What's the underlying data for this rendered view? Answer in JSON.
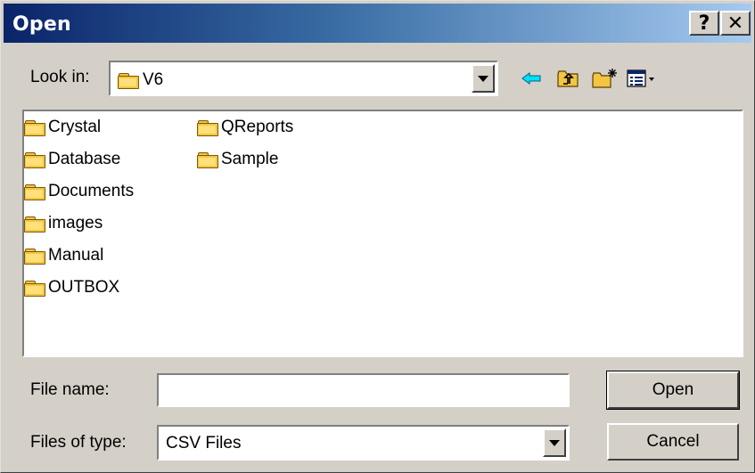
{
  "window": {
    "title": "Open",
    "help_label": "?",
    "close_label": "✕"
  },
  "look_in": {
    "label": "Look in:",
    "value": "V6"
  },
  "toolbar": {
    "back_icon": "arrow-left-icon",
    "up_icon": "up-folder-icon",
    "new_folder_icon": "new-folder-icon",
    "view_icon": "view-menu-icon"
  },
  "files": [
    {
      "name": "Crystal"
    },
    {
      "name": "Database"
    },
    {
      "name": "Documents"
    },
    {
      "name": "images"
    },
    {
      "name": "Manual"
    },
    {
      "name": "OUTBOX"
    },
    {
      "name": "QReports"
    },
    {
      "name": "Sample"
    }
  ],
  "file_name": {
    "label": "File name:",
    "value": ""
  },
  "file_type": {
    "label": "Files of type:",
    "value": "CSV Files"
  },
  "buttons": {
    "open": "Open",
    "cancel": "Cancel"
  },
  "colors": {
    "title_start": "#0a246a",
    "title_end": "#a6caf0",
    "face": "#d4d0c8",
    "folder": "#f4c542"
  }
}
